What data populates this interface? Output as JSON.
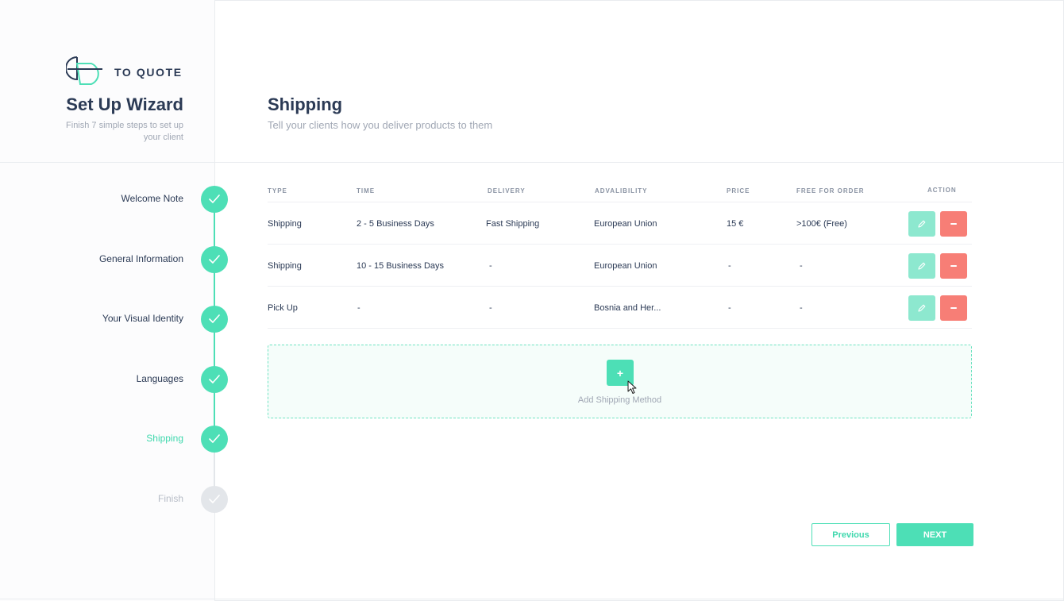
{
  "brand": {
    "name": "TO QUOTE",
    "logo_icon": "to-quote-logo-icon"
  },
  "wizard": {
    "title": "Set Up Wizard",
    "subtitle": "Finish 7 simple steps to set up your client",
    "steps": [
      {
        "label": "Welcome Note",
        "status": "done"
      },
      {
        "label": "General Information",
        "status": "done"
      },
      {
        "label": "Your Visual Identity",
        "status": "done"
      },
      {
        "label": "Languages",
        "status": "done"
      },
      {
        "label": "Shipping",
        "status": "current"
      },
      {
        "label": "Finish",
        "status": "pending"
      }
    ],
    "step_icon": "check-icon"
  },
  "page": {
    "title": "Shipping",
    "subtitle": "Tell your clients how you deliver products to them"
  },
  "table": {
    "headers": {
      "type": "TYPE",
      "time": "TIME",
      "delivery": "DELIVERY",
      "availability": "ADVALIBILITY",
      "price": "PRICE",
      "free": "FREE FOR ORDER",
      "action": "ACTION"
    },
    "rows": [
      {
        "type": "Shipping",
        "time": "2 - 5 Business Days",
        "delivery": "Fast Shipping",
        "availability": "European Union",
        "price": "15 €",
        "free": ">100€ (Free)"
      },
      {
        "type": "Shipping",
        "time": "10 - 15 Business Days",
        "delivery": "-",
        "availability": "European Union",
        "price": "-",
        "free": "-"
      },
      {
        "type": "Pick Up",
        "time": "-",
        "delivery": "-",
        "availability": "Bosnia and Her...",
        "price": "-",
        "free": "-"
      }
    ],
    "edit_icon": "pencil-icon",
    "delete_icon": "minus-icon"
  },
  "add_method": {
    "label": "Add Shipping Method",
    "button_symbol": "+"
  },
  "nav": {
    "previous": "Previous",
    "next": "NEXT"
  },
  "colors": {
    "accent": "#4ddfb6",
    "danger": "#f77e76",
    "text": "#2b3a55",
    "muted": "#a0a7b4"
  }
}
